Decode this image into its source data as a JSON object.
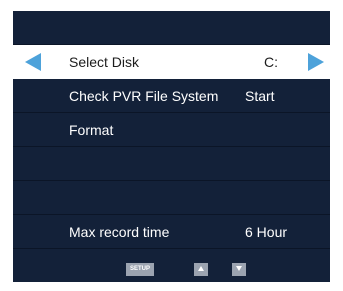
{
  "colors": {
    "panel_bg": "#132139",
    "row_divider": "#0b1527",
    "selected_bg": "#ffffff",
    "selected_text": "#1c1c1c",
    "text": "#ffffff",
    "disabled_text": "#28354e",
    "arrow": "#4da2da",
    "key_bg": "#9ba3b0"
  },
  "menu": {
    "items": [
      {
        "label": "",
        "value": "",
        "state": "header"
      },
      {
        "label": "Select Disk",
        "value": "C:",
        "state": "selected"
      },
      {
        "label": "Check PVR File System",
        "value": "Start",
        "state": "normal"
      },
      {
        "label": "Format",
        "value": "",
        "state": "normal"
      },
      {
        "label": "",
        "value": "",
        "state": "disabled"
      },
      {
        "label": "",
        "value": "",
        "state": "disabled"
      },
      {
        "label": "Max record time",
        "value": "6 Hour",
        "state": "normal"
      }
    ]
  },
  "footer": {
    "setup_label": "SETUP",
    "up_icon": "triangle-up-icon",
    "down_icon": "triangle-down-icon"
  }
}
